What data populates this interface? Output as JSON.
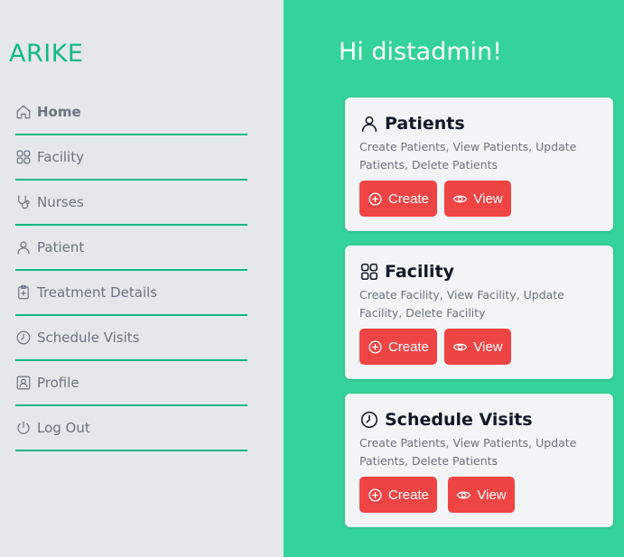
{
  "app": {
    "brand": "ARIKE"
  },
  "sidebar": {
    "items": [
      {
        "label": "Home",
        "icon": "home-icon"
      },
      {
        "label": "Facility",
        "icon": "grid-icon"
      },
      {
        "label": "Nurses",
        "icon": "stethoscope-icon"
      },
      {
        "label": "Patient",
        "icon": "user-icon"
      },
      {
        "label": "Treatment Details",
        "icon": "clipboard-icon"
      },
      {
        "label": "Schedule Visits",
        "icon": "clock-icon"
      },
      {
        "label": "Profile",
        "icon": "user-square-icon"
      },
      {
        "label": "Log Out",
        "icon": "power-icon"
      }
    ]
  },
  "main": {
    "greeting": "Hi distadmin!",
    "cards": [
      {
        "title": "Patients",
        "icon": "user-icon",
        "description": "Create Patients, View Patients, Update Patients, Delete Patients",
        "create_label": "Create",
        "view_label": "View"
      },
      {
        "title": "Facility",
        "icon": "grid-icon",
        "description": "Create Facility, View Facility, Update Facility, Delete Facility",
        "create_label": "Create",
        "view_label": "View"
      },
      {
        "title": "Schedule Visits",
        "icon": "clock-icon",
        "description": "Create Patients, View Patients, Update Patients, Delete Patients",
        "create_label": "Create",
        "view_label": "View"
      }
    ]
  },
  "colors": {
    "sidebar_bg": "#e5e7eb",
    "accent_green": "#10b981",
    "main_bg": "#34d399",
    "button_red": "#ef4444"
  }
}
